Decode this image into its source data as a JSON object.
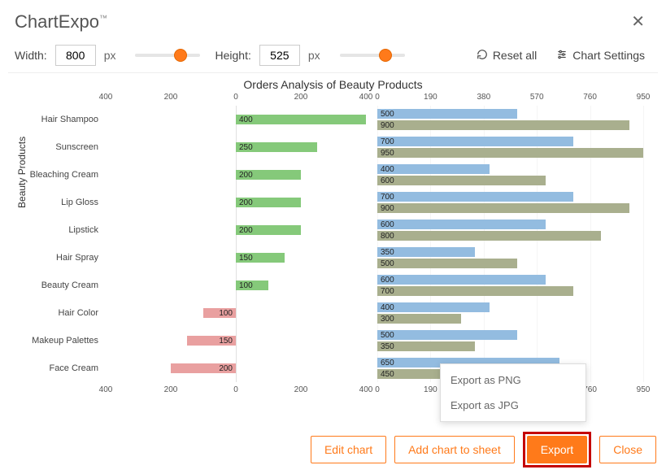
{
  "brand": {
    "name": "ChartExpo",
    "tm": "™"
  },
  "controls": {
    "width_label": "Width:",
    "width_value": "800",
    "height_label": "Height:",
    "height_value": "525",
    "unit": "px",
    "reset_label": "Reset all",
    "settings_label": "Chart Settings"
  },
  "chart_data": {
    "type": "bar",
    "title": "Orders Analysis of Beauty Products",
    "ylabel": "Beauty Products",
    "categories": [
      "Hair Shampoo",
      "Sunscreen",
      "Bleaching Cream",
      "Lip Gloss",
      "Lipstick",
      "Hair Spray",
      "Beauty Cream",
      "Hair Color",
      "Makeup Palettes",
      "Face Cream"
    ],
    "left_panel": {
      "range": [
        -400,
        400
      ],
      "ticks": [
        400,
        200,
        0,
        200,
        400
      ],
      "series": [
        {
          "name": "green-pink",
          "values": [
            400,
            250,
            200,
            200,
            200,
            150,
            100,
            -100,
            -150,
            -200
          ]
        }
      ]
    },
    "right_panel": {
      "range": [
        0,
        950
      ],
      "ticks": [
        0,
        190,
        380,
        570,
        760,
        950
      ],
      "series": [
        {
          "name": "blue",
          "values": [
            500,
            700,
            400,
            700,
            600,
            350,
            600,
            400,
            500,
            650
          ]
        },
        {
          "name": "olive",
          "values": [
            900,
            950,
            600,
            900,
            800,
            500,
            700,
            300,
            350,
            450
          ]
        }
      ]
    }
  },
  "popup": {
    "png": "Export as PNG",
    "jpg": "Export as JPG"
  },
  "buttons": {
    "edit": "Edit chart",
    "add": "Add chart to sheet",
    "export": "Export",
    "close": "Close"
  }
}
